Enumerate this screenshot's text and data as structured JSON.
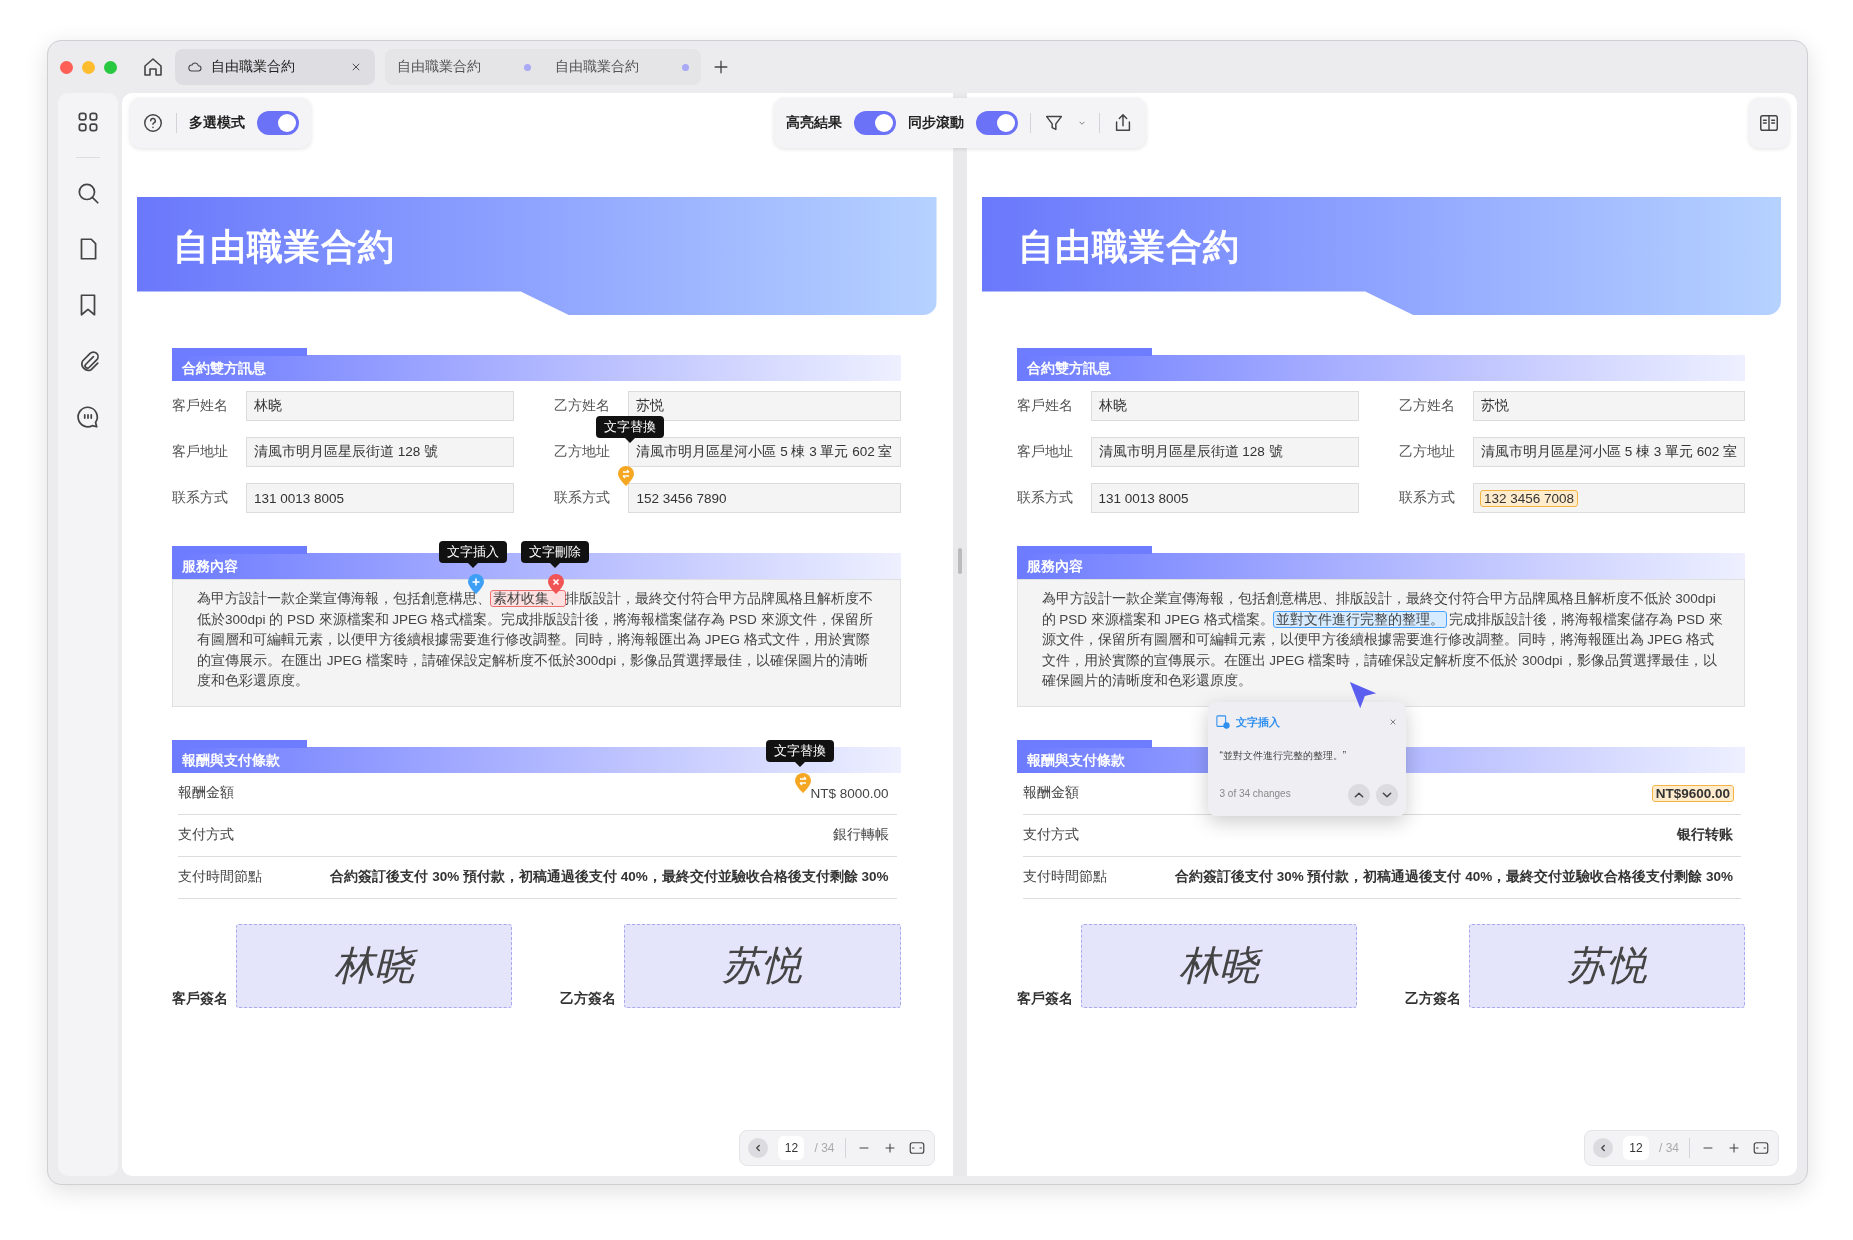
{
  "tabs": [
    {
      "label": "自由職業合約",
      "selected": true,
      "unsaved": false
    },
    {
      "label": "自由職業合約",
      "selected": false,
      "unsaved": true
    },
    {
      "label": "自由職業合約",
      "selected": false,
      "unsaved": true
    }
  ],
  "toolbar": {
    "left": [
      {
        "label": "多選模式",
        "on": true
      }
    ],
    "center": [
      {
        "label": "高亮結果",
        "on": true
      },
      {
        "label": "同步滾動",
        "on": true
      }
    ]
  },
  "documents": [
    {
      "title": "自由職業合約",
      "parties": {
        "heading": "合約雙方訊息",
        "columns": [
          [
            {
              "label": "客戶姓名",
              "value": "林晓",
              "highlighted": false
            },
            {
              "label": "客戶地址",
              "value": "清風市明月區星辰街道 128 號",
              "highlighted": false
            },
            {
              "label": "联系方式",
              "value": "131 0013 8005",
              "highlighted": false
            }
          ],
          [
            {
              "label": "乙方姓名",
              "value": "苏悦",
              "highlighted": false
            },
            {
              "label": "乙方地址",
              "value": "清風市明月區星河小區 5 棟 3 單元 602 室",
              "highlighted": false,
              "marker": {
                "kind": "replace",
                "tooltip": "文字替換"
              }
            },
            {
              "label": "联系方式",
              "value": "152 3456 7890",
              "highlighted": false
            }
          ]
        ]
      },
      "service": {
        "heading": "服務內容",
        "segments": [
          {
            "kind": "plain",
            "text": "為甲方設計一款企業宣傳海報，包括創意構思"
          },
          {
            "kind": "plain",
            "text": "、",
            "marker": {
              "kind": "insert",
              "tooltip": "文字插入"
            }
          },
          {
            "kind": "deleted",
            "text": "素材收集、",
            "marker": {
              "kind": "delete",
              "tooltip": "文字刪除"
            }
          },
          {
            "kind": "plain",
            "text": "排版設計，最終交付符合甲方品牌風格且解析度不低於300dpi 的 PSD 來源檔案和 JPEG 格式檔案。完成排版設計後，將海報檔案儲存為 PSD 來源文件，保留所有圖層和可編輯元素，以便甲方後續根據需要進行修改調整。同時，將海報匯出為 JPEG 格式文件，用於實際的宣傳展示。在匯出 JPEG 檔案時，請確保設定解析度不低於300dpi，影像品質選擇最佳，以確保圖片的清晰度和色彩還原度。"
          }
        ]
      },
      "payment": {
        "heading": "報酬與支付條款",
        "rows": [
          {
            "label": "報酬金額",
            "value": "NT$ 8000.00",
            "bold": false,
            "highlighted": false,
            "marker": {
              "kind": "replace",
              "tooltip": "文字替換"
            }
          },
          {
            "label": "支付方式",
            "value": "銀行轉帳",
            "bold": false,
            "highlighted": false
          },
          {
            "label": "支付時間節點",
            "value": "合約簽訂後支付 30% 預付款，初稿通過後支付 40%，最終交付並驗收合格後支付剩餘 30%",
            "bold": true,
            "highlighted": false
          }
        ]
      },
      "signatures": [
        {
          "label": "客戶簽名",
          "signature": "林晓"
        },
        {
          "label": "乙方簽名",
          "signature": "苏悦"
        }
      ],
      "pager": {
        "page": "12",
        "total": "/ 34"
      }
    },
    {
      "title": "自由職業合約",
      "parties": {
        "heading": "合約雙方訊息",
        "columns": [
          [
            {
              "label": "客戶姓名",
              "value": "林晓",
              "highlighted": false
            },
            {
              "label": "客戶地址",
              "value": "清風市明月區星辰街道 128 號",
              "highlighted": false
            },
            {
              "label": "联系方式",
              "value": "131 0013 8005",
              "highlighted": false
            }
          ],
          [
            {
              "label": "乙方姓名",
              "value": "苏悦",
              "highlighted": false
            },
            {
              "label": "乙方地址",
              "value": "清風市明月區星河小區 5 棟 3 單元 602 室",
              "highlighted": false
            },
            {
              "label": "联系方式",
              "value": "132 3456 7008",
              "highlighted": true
            }
          ]
        ]
      },
      "service": {
        "heading": "服務內容",
        "segments": [
          {
            "kind": "plain",
            "text": "為甲方設計一款企業宣傳海報，包括創意構思、排版設計，最終交付符合甲方品牌風格且解析度不低於 300dpi 的 PSD 來源檔案和 JPEG 格式檔案。"
          },
          {
            "kind": "inserted",
            "text": "並對文件進行完整的整理。"
          },
          {
            "kind": "plain",
            "text": " 完成排版設計後，將海報檔案儲存為 PSD 來源文件，保留所有圖層和可編輯元素，以便甲方後續根據需要進行修改調整。同時，將海報匯出為 JPEG 格式文件，用於實際的宣傳展示。在匯出 JPEG 檔案時，請確保設定解析度不低於 300dpi，影像品質選擇最佳，以確保圖片的清晰度和色彩還原度。"
          }
        ]
      },
      "payment": {
        "heading": "報酬與支付條款",
        "rows": [
          {
            "label": "報酬金額",
            "value": "NT$9600.00",
            "bold": true,
            "highlighted": true
          },
          {
            "label": "支付方式",
            "value": "银行转账",
            "bold": true,
            "highlighted": false
          },
          {
            "label": "支付時間節點",
            "value": "合約簽訂後支付 30% 預付款，初稿通過後支付 40%，最終交付並驗收合格後支付剩餘 30%",
            "bold": true,
            "highlighted": false
          }
        ]
      },
      "signatures": [
        {
          "label": "客戶簽名",
          "signature": "林晓"
        },
        {
          "label": "乙方簽名",
          "signature": "苏悦"
        }
      ],
      "popup": {
        "title": "文字插入",
        "quote": "“並對文件進行完整的整理。”",
        "counter": "3 of 34 changes"
      },
      "pager": {
        "page": "12",
        "total": "/ 34"
      }
    }
  ]
}
